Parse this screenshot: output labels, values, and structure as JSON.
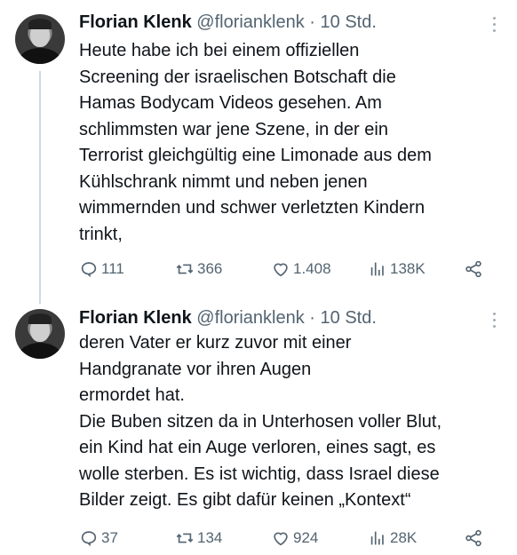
{
  "tweets": [
    {
      "name": "Florian Klenk",
      "handle": "@florianklenk",
      "sep": "·",
      "time": "10 Std.",
      "text": "Heute habe ich bei einem offiziellen\nScreening der israelischen Botschaft die\nHamas Bodycam Videos gesehen. Am\nschlimmsten war jene Szene, in der ein\nTerrorist gleichgültig eine Limonade aus dem\nKühlschrank nimmt und neben jenen\nwimmernden und schwer verletzten Kindern\ntrinkt,",
      "replies": "111",
      "retweets": "366",
      "likes": "1.408",
      "views": "138K"
    },
    {
      "name": "Florian Klenk",
      "handle": "@florianklenk",
      "sep": "·",
      "time": "10 Std.",
      "text": "deren Vater er kurz zuvor mit einer\nHandgranate vor ihren Augen\nermordet hat.\nDie Buben sitzen da in Unterhosen voller Blut,\nein Kind hat ein Auge verloren, eines sagt, es\nwolle sterben. Es ist wichtig,  dass Israel diese\nBilder zeigt. Es gibt dafür keinen „Kontext“",
      "replies": "37",
      "retweets": "134",
      "likes": "924",
      "views": "28K"
    }
  ],
  "icons": {
    "reply": "reply-icon",
    "retweet": "retweet-icon",
    "like": "heart-icon",
    "views": "views-icon",
    "share": "share-icon",
    "more": "more-icon"
  },
  "colors": {
    "text": "#0f1419",
    "secondary": "#536471",
    "thread_line": "#cfd9de"
  }
}
